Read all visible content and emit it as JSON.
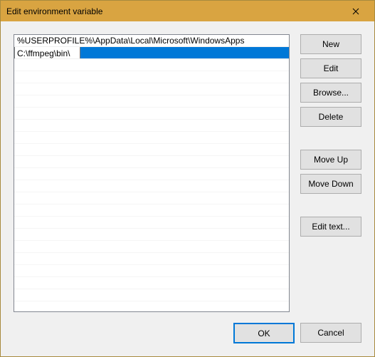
{
  "window": {
    "title": "Edit environment variable"
  },
  "list": {
    "entries": [
      "%USERPROFILE%\\AppData\\Local\\Microsoft\\WindowsApps",
      "C:\\ffmpeg\\bin\\"
    ],
    "editing_index": 1
  },
  "buttons": {
    "new": "New",
    "edit": "Edit",
    "browse": "Browse...",
    "delete": "Delete",
    "move_up": "Move Up",
    "move_down": "Move Down",
    "edit_text": "Edit text...",
    "ok": "OK",
    "cancel": "Cancel"
  }
}
